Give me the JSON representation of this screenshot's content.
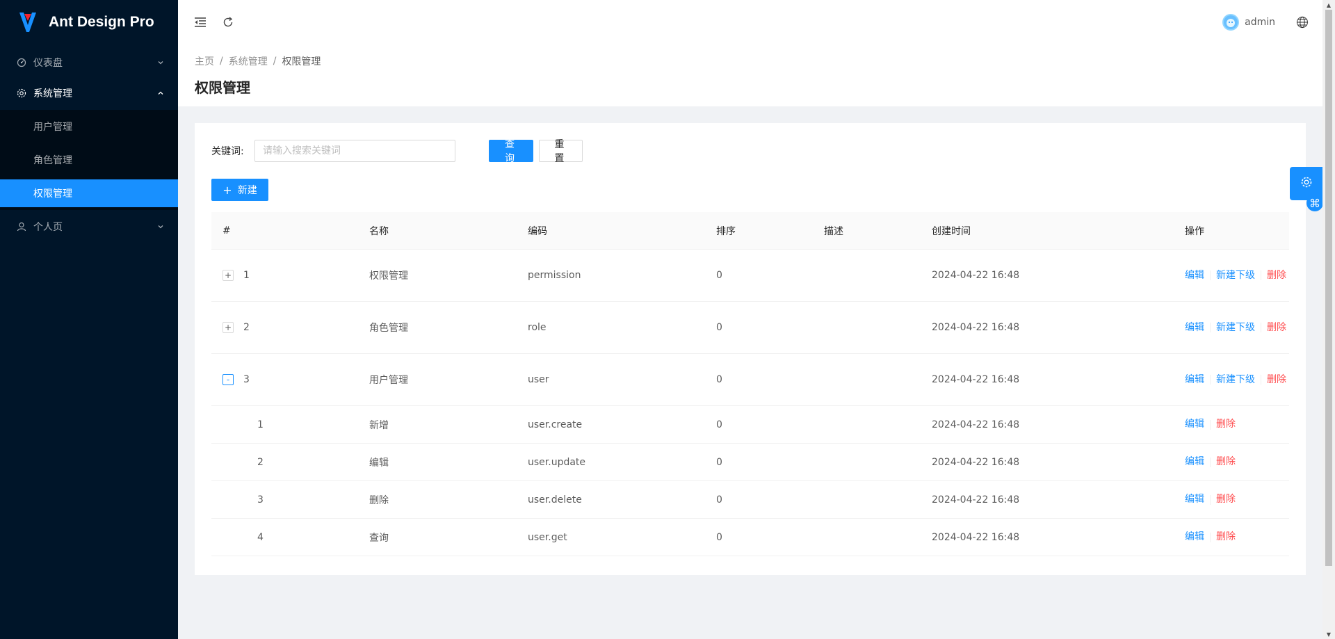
{
  "app": {
    "title": "Ant Design Pro"
  },
  "sidebar": {
    "items": [
      {
        "label": "仪表盘",
        "icon": "dashboard-icon"
      },
      {
        "label": "系统管理",
        "icon": "setting-icon",
        "open": true,
        "children": [
          {
            "label": "用户管理"
          },
          {
            "label": "角色管理"
          },
          {
            "label": "权限管理",
            "selected": true
          }
        ]
      },
      {
        "label": "个人页",
        "icon": "user-icon"
      }
    ]
  },
  "header": {
    "username": "admin"
  },
  "breadcrumb": {
    "items": [
      "主页",
      "系统管理",
      "权限管理"
    ],
    "separator": "/"
  },
  "page": {
    "title": "权限管理"
  },
  "search": {
    "label": "关键词:",
    "placeholder": "请输入搜索关键词",
    "value": "",
    "query_label": "查询",
    "reset_label": "重置"
  },
  "toolbar": {
    "new_label": "新建"
  },
  "table": {
    "columns": [
      "#",
      "名称",
      "编码",
      "排序",
      "描述",
      "创建时间",
      "操作"
    ],
    "rows": [
      {
        "idx": "1",
        "name": "权限管理",
        "code": "permission",
        "sort": "0",
        "desc": "",
        "time": "2024-04-22 16:48",
        "expand": "+",
        "level": 0
      },
      {
        "idx": "2",
        "name": "角色管理",
        "code": "role",
        "sort": "0",
        "desc": "",
        "time": "2024-04-22 16:48",
        "expand": "+",
        "level": 0
      },
      {
        "idx": "3",
        "name": "用户管理",
        "code": "user",
        "sort": "0",
        "desc": "",
        "time": "2024-04-22 16:48",
        "expand": "-",
        "level": 0
      },
      {
        "idx": "1",
        "name": "新增",
        "code": "user.create",
        "sort": "0",
        "desc": "",
        "time": "2024-04-22 16:48",
        "level": 1
      },
      {
        "idx": "2",
        "name": "编辑",
        "code": "user.update",
        "sort": "0",
        "desc": "",
        "time": "2024-04-22 16:48",
        "level": 1
      },
      {
        "idx": "3",
        "name": "删除",
        "code": "user.delete",
        "sort": "0",
        "desc": "",
        "time": "2024-04-22 16:48",
        "level": 1
      },
      {
        "idx": "4",
        "name": "查询",
        "code": "user.get",
        "sort": "0",
        "desc": "",
        "time": "2024-04-22 16:48",
        "level": 1
      }
    ],
    "ops": {
      "edit": "编辑",
      "add_child": "新建下级",
      "delete": "删除"
    }
  },
  "colors": {
    "primary": "#1890ff",
    "danger": "#ff4d4f",
    "sider": "#001529",
    "submenu": "#000c17"
  }
}
